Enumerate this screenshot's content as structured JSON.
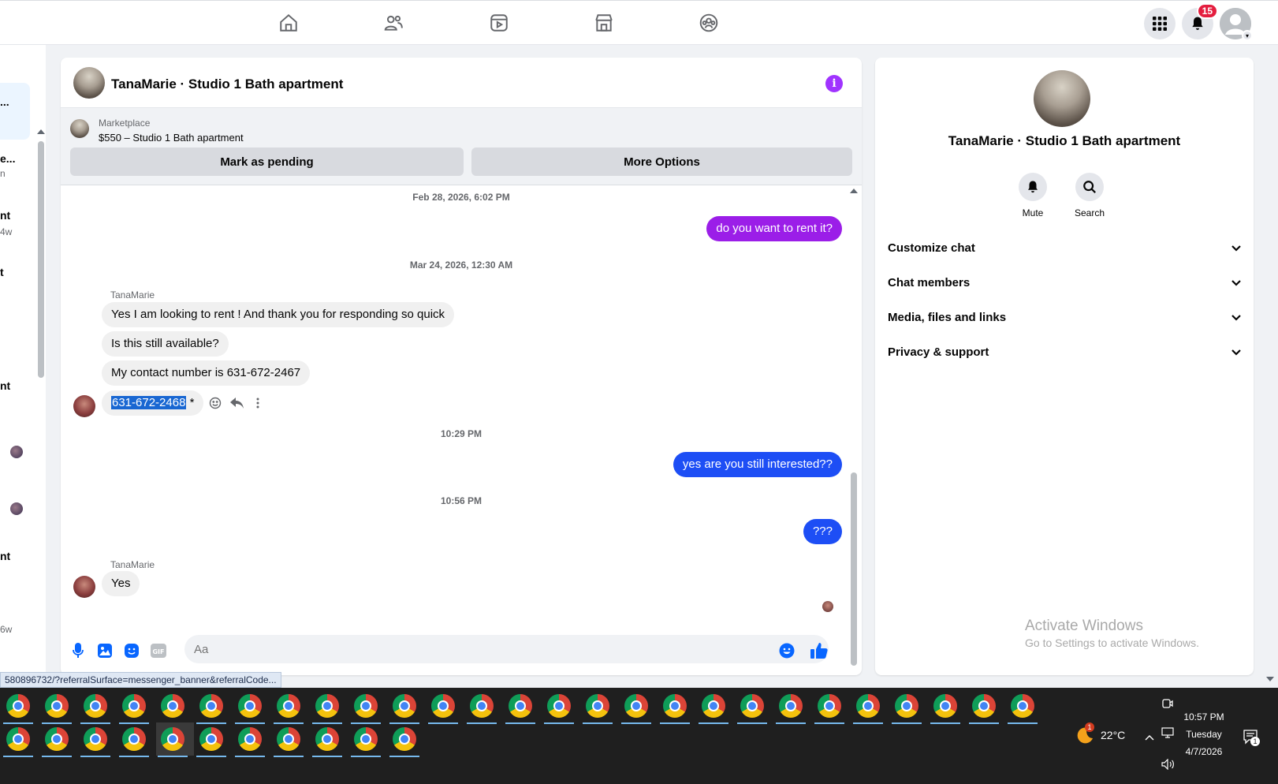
{
  "topnav": {
    "icons": [
      "home-icon",
      "friends-icon",
      "video-icon",
      "marketplace-icon",
      "groups-icon"
    ],
    "notifications_badge": "15"
  },
  "left": {
    "snippets": [
      "...",
      "e...",
      "n",
      "nt",
      "4w",
      "t",
      "nt",
      "nt",
      "6w"
    ]
  },
  "chat": {
    "title": "TanaMarie · Studio 1 Bath apartment",
    "marketplace_label": "Marketplace",
    "listing": "$550 – Studio 1 Bath apartment",
    "mark_pending": "Mark as pending",
    "more_options": "More Options",
    "ts1": "Feb 28, 2026, 6:02 PM",
    "out1": "do you want to rent it?",
    "ts2": "Mar 24, 2026, 12:30 AM",
    "sender": "TanaMarie",
    "in1": "Yes I am looking to rent ! And thank you for responding so quick",
    "in2": "Is this still available?",
    "in3": "My contact number is 631-672-2467",
    "in4_phone": "631-672-2468",
    "in4_suffix": " *",
    "ts3": "10:29 PM",
    "out2": "yes are you still interested??",
    "ts4": "10:56 PM",
    "out3": "???",
    "sender2": "TanaMarie",
    "in5": "Yes",
    "composer_placeholder": "Aa",
    "colors": {
      "outgoing_purple": "#9b1ee8",
      "outgoing_blue": "#1d4ef5",
      "accent": "#a033ff"
    }
  },
  "status_url": "580896732/?referralSurface=messenger_banner&referralCode...",
  "side": {
    "title": "TanaMarie · Studio 1 Bath apartment",
    "mute": "Mute",
    "search": "Search",
    "rows": [
      "Customize chat",
      "Chat members",
      "Media, files and links",
      "Privacy & support"
    ],
    "activate1": "Activate Windows",
    "activate2": "Go to Settings to activate Windows."
  },
  "taskbar": {
    "temperature": "22°C",
    "time": "10:57 PM",
    "day": "Tuesday",
    "date": "4/7/2026",
    "weather_alert": "1",
    "action_count": "1"
  }
}
